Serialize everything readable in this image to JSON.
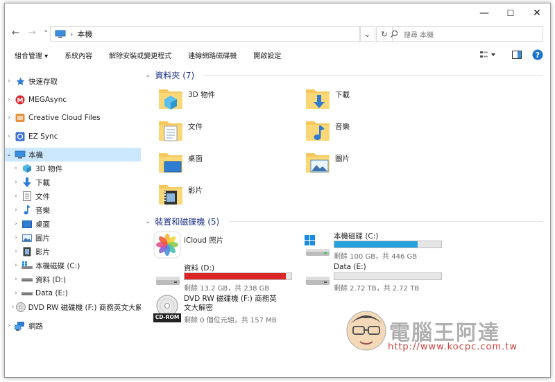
{
  "titlebar": {
    "minimize": "—",
    "maximize": "☐",
    "close": "✕"
  },
  "address": {
    "back": "←",
    "forward": "→",
    "recent": "⌄",
    "arrow": "›",
    "path": "本機",
    "refresh": "↻",
    "dropdown": "⌄"
  },
  "search": {
    "placeholder": "搜尋 本機",
    "icon": "search-icon"
  },
  "command_bar": {
    "items": [
      "組合管理 ▾",
      "系統內容",
      "解除安裝或變更程式",
      "連線網路磁碟機",
      "開啟設定"
    ]
  },
  "sidebar": {
    "items": [
      {
        "label": "快速存取",
        "icon": "star-icon"
      },
      {
        "label": "MEGAsync",
        "icon": "mega-icon"
      },
      {
        "label": "Creative Cloud Files",
        "icon": "creative-cloud-icon"
      },
      {
        "label": "EZ Sync",
        "icon": "ez-sync-icon"
      },
      {
        "label": "本機",
        "icon": "computer-icon"
      },
      {
        "label": "3D 物件",
        "icon": "3d-objects-icon"
      },
      {
        "label": "下載",
        "icon": "download-icon"
      },
      {
        "label": "文件",
        "icon": "document-icon"
      },
      {
        "label": "音樂",
        "icon": "music-icon"
      },
      {
        "label": "桌面",
        "icon": "desktop-icon"
      },
      {
        "label": "圖片",
        "icon": "picture-icon"
      },
      {
        "label": "影片",
        "icon": "video-icon"
      },
      {
        "label": "本機磁碟 (C:)",
        "icon": "drive-icon"
      },
      {
        "label": "資料 (D:)",
        "icon": "drive-icon"
      },
      {
        "label": "Data (E:)",
        "icon": "drive-icon"
      },
      {
        "label": "DVD RW 磁碟機 (F:) 商務英文大解",
        "icon": "dvd-icon"
      },
      {
        "label": "網路",
        "icon": "network-icon"
      }
    ]
  },
  "folders_group": {
    "title": "資料夾 (7)"
  },
  "folders": [
    {
      "label": "3D 物件",
      "icon": "3d-objects-folder-icon"
    },
    {
      "label": "下載",
      "icon": "download-folder-icon"
    },
    {
      "label": "文件",
      "icon": "document-folder-icon"
    },
    {
      "label": "音樂",
      "icon": "music-folder-icon"
    },
    {
      "label": "桌面",
      "icon": "desktop-folder-icon"
    },
    {
      "label": "圖片",
      "icon": "picture-folder-icon"
    },
    {
      "label": "影片",
      "icon": "video-folder-icon"
    }
  ],
  "drives_group": {
    "title": "裝置和磁碟機 (5)"
  },
  "drives": [
    {
      "label": "iCloud 照片",
      "icon": "icloud-photos-icon",
      "sub": "",
      "used_fraction": null
    },
    {
      "label": "本機磁碟 (C:)",
      "icon": "windows-drive-icon",
      "sub": "剩餘 100 GB，共 446 GB",
      "used_fraction": 0.776,
      "bar_color": "#26a0da"
    },
    {
      "label": "資料 (D:)",
      "icon": "hdd-icon",
      "sub": "剩餘 13.2 GB，共 238 GB",
      "used_fraction": 0.945,
      "bar_color": "#da2626"
    },
    {
      "label": "Data (E:)",
      "icon": "hdd-icon",
      "sub": "剩餘 2.72 TB，共 2.72 TB",
      "used_fraction": 0.0,
      "bar_color": "#26a0da"
    },
    {
      "label": "DVD RW 磁碟機 (F:) 商務英文大解密",
      "icon": "cd-rom-icon",
      "sub": "剩餘 0 個位元組，共 157 MB",
      "used_fraction": null,
      "cdrom_badge": "CD-ROM"
    }
  ],
  "watermark": {
    "title": "電腦王阿達",
    "url": "http://www.kocpc.com.tw"
  },
  "colors": {
    "selection": "#cce8ff",
    "group_header": "#1e3287",
    "accent": "#26a0da",
    "full": "#da2626"
  }
}
